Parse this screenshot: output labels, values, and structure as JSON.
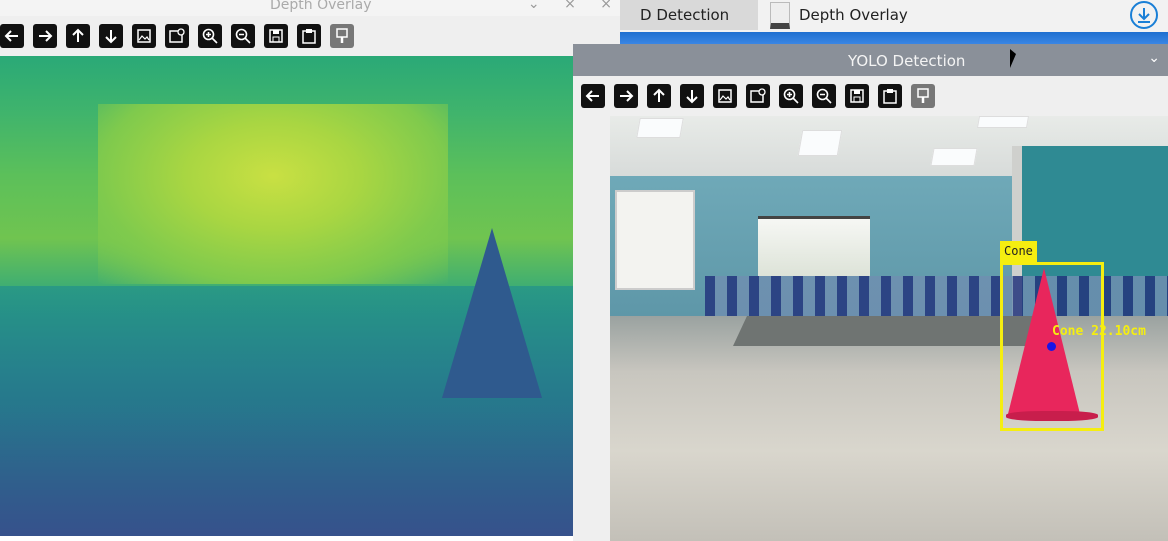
{
  "taskbar": {
    "tab1_label": "D Detection",
    "tab2_label": "Depth Overlay",
    "download_icon": "download-icon"
  },
  "depth_window": {
    "title": "Depth Overlay",
    "controls": "⌄ × ×",
    "toolbar_icons": [
      "arrow-left-icon",
      "arrow-right-icon",
      "arrow-up-icon",
      "arrow-down-icon",
      "image-icon",
      "image-settings-icon",
      "zoom-in-icon",
      "zoom-out-icon",
      "save-icon",
      "clipboard-icon",
      "brush-icon"
    ]
  },
  "yolo_window": {
    "title": "YOLO Detection",
    "menu_glyph": "⌄",
    "toolbar_icons": [
      "arrow-left-icon",
      "arrow-right-icon",
      "arrow-up-icon",
      "arrow-down-icon",
      "image-icon",
      "image-settings-icon",
      "zoom-in-icon",
      "zoom-out-icon",
      "save-icon",
      "clipboard-icon",
      "brush-icon"
    ],
    "detection": {
      "class_label": "Cone",
      "distance_label": "Cone 22.10cm",
      "box_color": "#f5ee10",
      "center_color": "#1a14e6"
    }
  }
}
